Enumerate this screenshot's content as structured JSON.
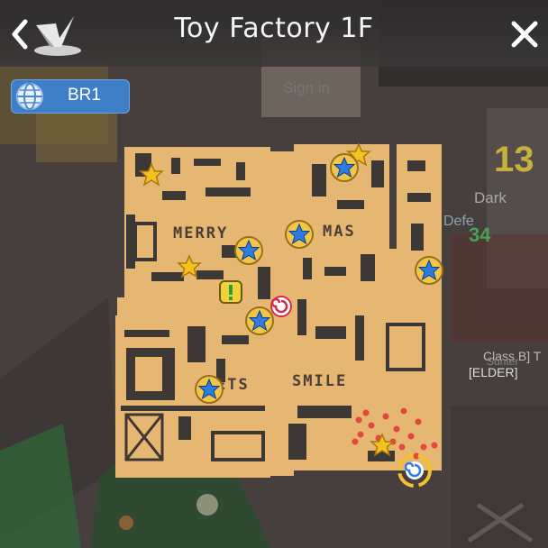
{
  "header": {
    "title": "Toy Factory 1F"
  },
  "channel": {
    "label": "BR1"
  },
  "map": {
    "floor_words": [
      "MERRY",
      "MAS",
      "ETS",
      "SMILE"
    ],
    "markers": [
      {
        "type": "star-icon"
      },
      {
        "type": "star-icon"
      },
      {
        "type": "star-icon"
      },
      {
        "type": "portal-star-icon"
      },
      {
        "type": "portal-star-icon"
      },
      {
        "type": "portal-star-icon"
      },
      {
        "type": "portal-star-icon"
      },
      {
        "type": "portal-star-icon"
      },
      {
        "type": "portal-star-icon"
      },
      {
        "type": "portal-star-icon"
      },
      {
        "type": "quest-icon"
      },
      {
        "type": "swirl-icon"
      },
      {
        "type": "player-icon"
      },
      {
        "type": "enemy-dot-cluster"
      }
    ]
  },
  "colors": {
    "map_floor": "#e6b673",
    "map_wall": "#3d3735",
    "channel_bg": "#3f7fc8",
    "star_gold": "#f3c21e",
    "portal_blue": "#2f7ce0",
    "enemy_red": "#e3473f"
  },
  "background_text": {
    "sign": "Sign in",
    "dark": "Dark",
    "defense": "Defe",
    "number": "13",
    "hp": "34",
    "class_line": "Class B] T",
    "elder": "[ELDER]",
    "under": "Sunter"
  }
}
